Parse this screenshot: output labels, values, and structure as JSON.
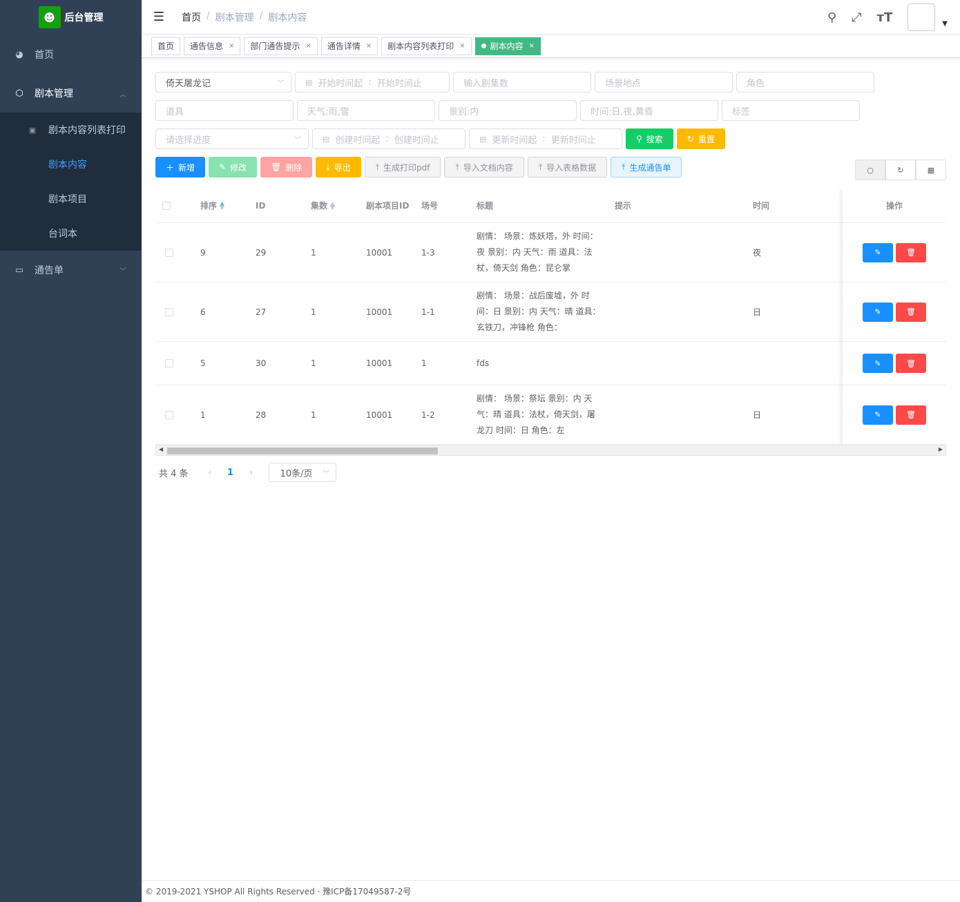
{
  "app": {
    "title": "后台管理"
  },
  "sidebar": {
    "home": "首页",
    "script_mgmt": "剧本管理",
    "sub_items": [
      "剧本内容列表打印",
      "剧本内容",
      "剧本项目",
      "台词本"
    ],
    "notice": "通告单"
  },
  "breadcrumb": [
    "首页",
    "剧本管理",
    "剧本内容"
  ],
  "tags": [
    "首页",
    "通告信息",
    "部门通告提示",
    "通告详情",
    "剧本内容列表打印",
    "剧本内容"
  ],
  "filters": {
    "project_value": "倚天屠龙记",
    "start_from": "开始时间起",
    "start_to": "开始时间止",
    "episode": "输入剧集数",
    "location": "场景地点",
    "role": "角色",
    "prop": "道具",
    "weather": "天气:雨,雪",
    "scene_type": "景别:内",
    "time": "时间:日,夜,黄昏",
    "tag": "标签",
    "progress": "请选择进度",
    "create_from": "创建时间起",
    "create_to": "创建时间止",
    "update_from": "更新时间起",
    "update_to": "更新时间止",
    "search": "搜索",
    "reset": "重置"
  },
  "toolbar": {
    "add": "新增",
    "edit": "修改",
    "delete": "删除",
    "export": "导出",
    "gen_pdf": "生成打印pdf",
    "import_doc": "导入文档内容",
    "import_sheet": "导入表格数据",
    "gen_notice": "生成通告单"
  },
  "table": {
    "headers": [
      "排序",
      "ID",
      "集数",
      "剧本项目ID",
      "场号",
      "标题",
      "提示",
      "时间",
      "操作"
    ],
    "rows": [
      {
        "sort": "9",
        "id": "29",
        "ep": "1",
        "pid": "10001",
        "scene": "1-3",
        "title": "剧情： 场景：炼妖塔，外 时间：夜 景别：内 天气：雨 道具：法杖，倚天剑 角色：昆仑掌",
        "hint": "",
        "time": "夜"
      },
      {
        "sort": "6",
        "id": "27",
        "ep": "1",
        "pid": "10001",
        "scene": "1-1",
        "title": "剧情： 场景：战后废墟，外 时间：日 景别：内 天气：晴 道具：玄铁刀，冲锋枪 角色：",
        "hint": "",
        "time": "日"
      },
      {
        "sort": "5",
        "id": "30",
        "ep": "1",
        "pid": "10001",
        "scene": "1",
        "title": "fds",
        "hint": "",
        "time": ""
      },
      {
        "sort": "1",
        "id": "28",
        "ep": "1",
        "pid": "10001",
        "scene": "1-2",
        "title": "剧情： 场景：祭坛 景别：内 天气：晴 道具：法杖，倚天剑，屠龙刀 时间：日 角色：左",
        "hint": "",
        "time": "日"
      }
    ]
  },
  "pager": {
    "total": "共 4 条",
    "page": "1",
    "size": "10条/页"
  },
  "footer": "© 2019-2021 YSHOP All Rights Reserved · 豫ICP备17049587-2号",
  "colors": {
    "sidebar": "#304156",
    "accent": "#1890ff",
    "tag_active": "#42b983"
  }
}
